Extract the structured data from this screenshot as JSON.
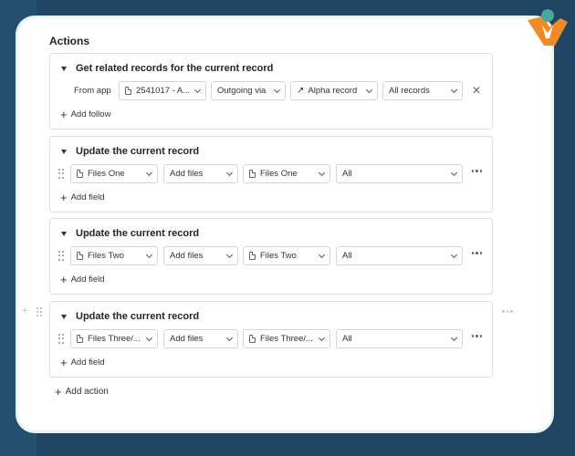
{
  "title": "Actions",
  "blocks": [
    {
      "header": "Get related records for the current record",
      "from_label": "From app",
      "app": "2541017 - A...",
      "link_type": "Outgoing via",
      "record": "Alpha record",
      "scope": "All records",
      "add_label": "Add follow"
    },
    {
      "header": "Update the current record",
      "field": "Files One",
      "mode": "Add files",
      "source": "Files One",
      "filter": "All",
      "add_label": "Add field"
    },
    {
      "header": "Update the current record",
      "field": "Files Two",
      "mode": "Add files",
      "source": "Files Two",
      "filter": "All",
      "add_label": "Add field"
    },
    {
      "header": "Update the current record",
      "field": "Files Three/...",
      "mode": "Add files",
      "source": "Files Three/...",
      "filter": "All",
      "add_label": "Add field"
    }
  ],
  "add_action_label": "Add action",
  "icons": {
    "remove": "close-icon",
    "more": "more-horizontal-icon",
    "add": "plus-icon",
    "drag": "drag-handle-icon",
    "collapse": "caret-down-icon",
    "file": "file-icon",
    "link": "arrow-up-right-icon"
  },
  "colors": {
    "background": "#1f4563",
    "card": "#ffffff",
    "border": "#dcdfe3",
    "logo_orange": "#f08a24",
    "logo_teal": "#4aa79b"
  }
}
